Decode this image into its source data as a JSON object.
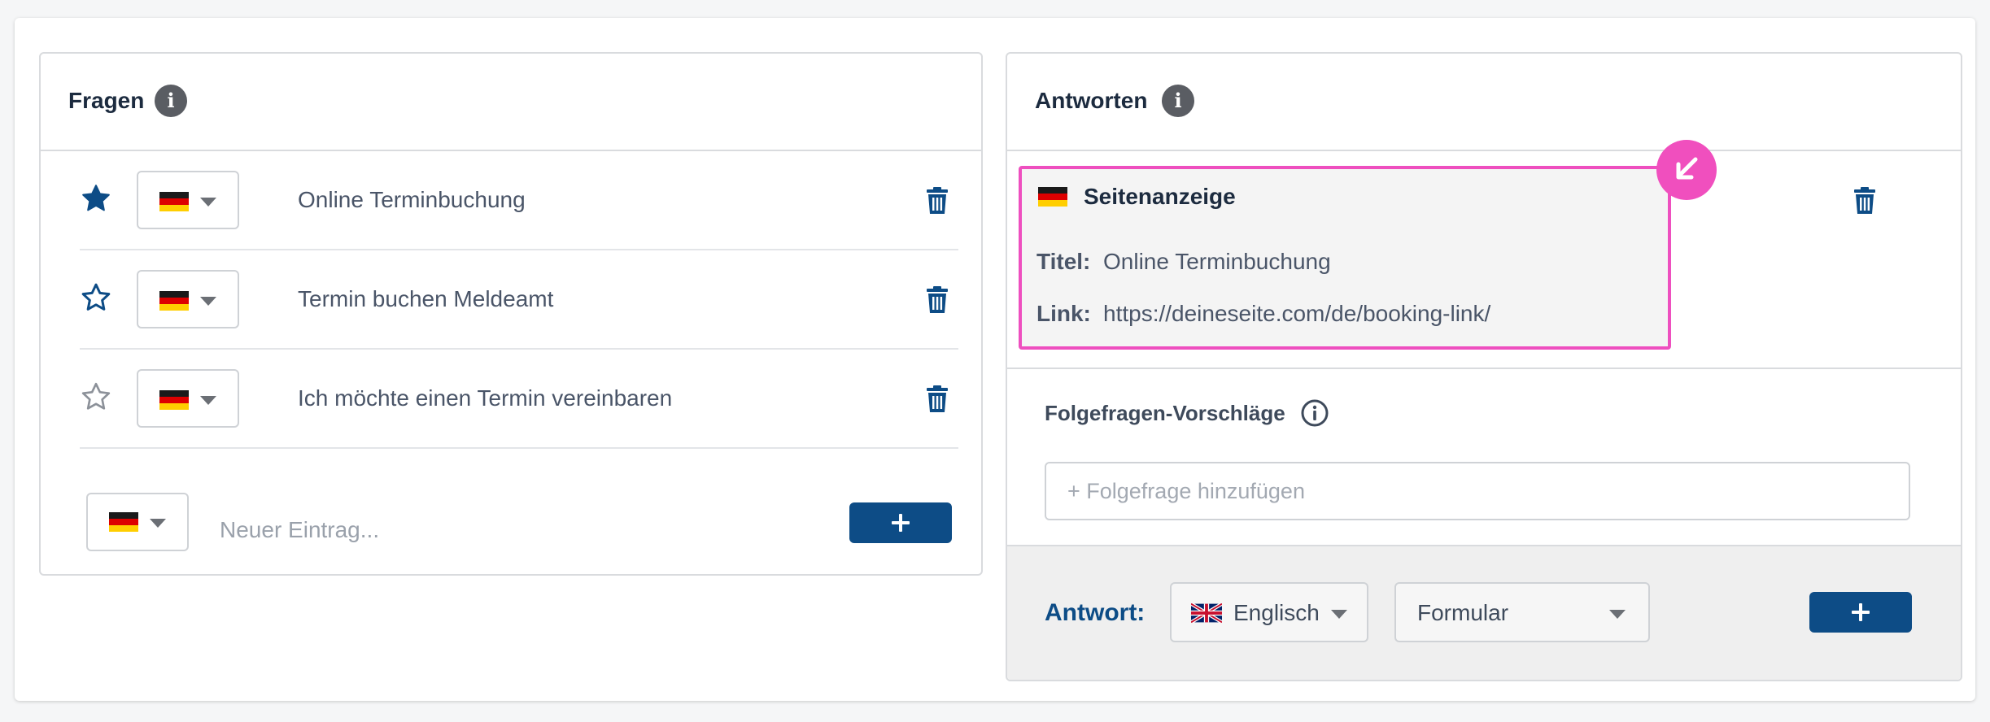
{
  "questions_panel": {
    "title": "Fragen",
    "info_icon": "info-icon",
    "items": [
      {
        "text": "Online Terminbuchung",
        "language": "Deutsch",
        "flag": "de-flag",
        "starred": "filled",
        "delete_icon": "trash-icon"
      },
      {
        "text": "Termin buchen Meldeamt",
        "language": "Deutsch",
        "flag": "de-flag",
        "starred": "outline",
        "delete_icon": "trash-icon"
      },
      {
        "text": "Ich möchte einen Termin vereinbaren",
        "language": "Deutsch",
        "flag": "de-flag",
        "starred": "outline-light",
        "delete_icon": "trash-icon"
      }
    ],
    "new_entry": {
      "placeholder": "Neuer Eintrag...",
      "language": "Deutsch",
      "flag": "de-flag",
      "add_icon": "plus-icon"
    }
  },
  "answers_panel": {
    "title": "Antworten",
    "info_icon": "info-icon",
    "answer_card": {
      "type_label": "Seitenanzeige",
      "flag": "de-flag",
      "title_label": "Titel:",
      "title_value": "Online Terminbuchung",
      "link_label": "Link:",
      "link_value": "https://deineseite.com/de/booking-link/",
      "badge_icon": "arrow-down-left-icon",
      "highlight_color": "#ee4fbf",
      "delete_icon": "trash-icon"
    },
    "followup": {
      "label": "Folgefragen-Vorschläge",
      "info_icon": "info-outline-icon",
      "placeholder": "+ Folgefrage hinzufügen"
    },
    "footer": {
      "label": "Antwort:",
      "language": "Englisch",
      "language_flag": "uk-flag",
      "type": "Formular",
      "add_icon": "plus-icon"
    }
  },
  "colors": {
    "primary": "#0d4c86",
    "text": "#3e4a5b",
    "heading": "#1c2b3f",
    "highlight": "#ee4fbf"
  }
}
